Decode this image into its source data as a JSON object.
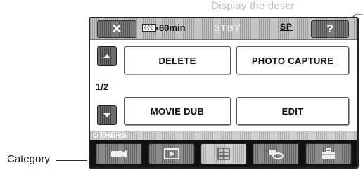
{
  "caption": {
    "top_text": "Display the descr"
  },
  "header": {
    "close_glyph": "✕",
    "battery_text": "60min",
    "status": "STBY",
    "quality": "SP",
    "help_glyph": "?"
  },
  "menu": {
    "page_indicator": "1/2",
    "items": [
      {
        "label": "DELETE"
      },
      {
        "label": "PHOTO CAPTURE"
      },
      {
        "label": "MOVIE DUB"
      },
      {
        "label": "EDIT"
      }
    ]
  },
  "category": {
    "section_label": "OTHERS",
    "callout_label": "Category",
    "tabs": [
      {
        "icon": "camera-icon"
      },
      {
        "icon": "play-icon"
      },
      {
        "icon": "grid-icon"
      },
      {
        "icon": "dub-icon"
      },
      {
        "icon": "toolbox-icon"
      }
    ]
  }
}
